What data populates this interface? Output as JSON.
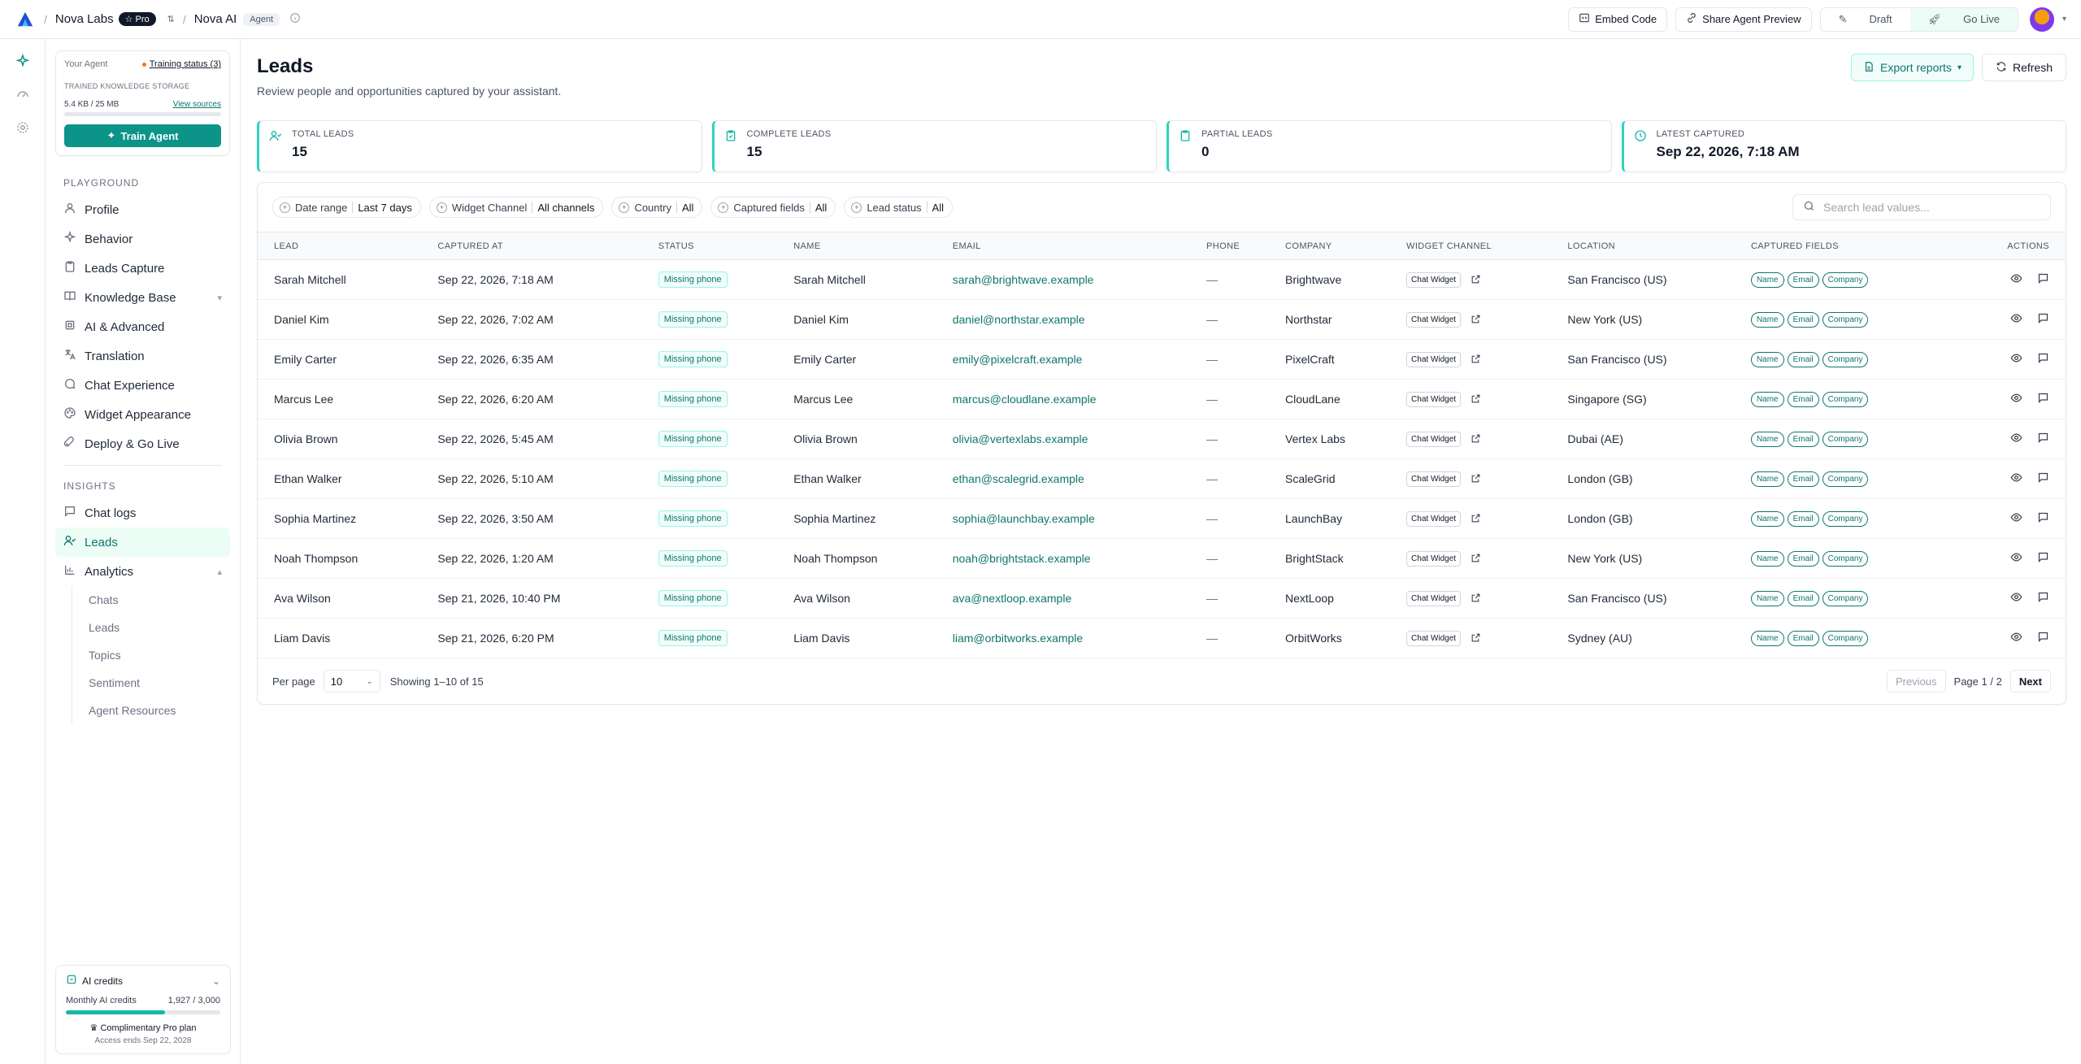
{
  "topbar": {
    "workspace": "Nova Labs",
    "plan_badge": "Pro",
    "agent_name": "Nova AI",
    "agent_badge": "Agent",
    "embed_label": "Embed Code",
    "share_label": "Share Agent Preview",
    "draft_label": "Draft",
    "live_label": "Go Live"
  },
  "sidebar": {
    "agent_card": {
      "title": "Your Agent",
      "training_status": "Training status (3)",
      "storage_label": "TRAINED KNOWLEDGE STORAGE",
      "storage_value": "5.4 KB / 25 MB",
      "view_sources": "View sources",
      "train_label": "Train Agent"
    },
    "playground_title": "PLAYGROUND",
    "playground_items": [
      {
        "label": "Profile"
      },
      {
        "label": "Behavior"
      },
      {
        "label": "Leads Capture"
      },
      {
        "label": "Knowledge Base"
      },
      {
        "label": "AI & Advanced"
      },
      {
        "label": "Translation"
      },
      {
        "label": "Chat Experience"
      },
      {
        "label": "Widget Appearance"
      },
      {
        "label": "Deploy & Go Live"
      }
    ],
    "insights_title": "INSIGHTS",
    "insights_items": [
      {
        "label": "Chat logs"
      },
      {
        "label": "Leads"
      },
      {
        "label": "Analytics"
      }
    ],
    "analytics_sub": [
      "Chats",
      "Leads",
      "Topics",
      "Sentiment",
      "Agent Resources"
    ],
    "credits": {
      "title": "AI credits",
      "monthly_label": "Monthly AI credits",
      "monthly_value": "1,927 / 3,000",
      "used_fraction": 0.642,
      "plan": "Complimentary Pro plan",
      "ends": "Access ends Sep 22, 2028"
    }
  },
  "main": {
    "title": "Leads",
    "subtitle": "Review people and opportunities captured by your assistant.",
    "export_label": "Export reports",
    "refresh_label": "Refresh",
    "stats": [
      {
        "label": "TOTAL LEADS",
        "value": "15"
      },
      {
        "label": "COMPLETE LEADS",
        "value": "15"
      },
      {
        "label": "PARTIAL LEADS",
        "value": "0"
      },
      {
        "label": "LATEST CAPTURED",
        "value": "Sep 22, 2026, 7:18 AM"
      }
    ],
    "filters": [
      {
        "label": "Date range",
        "value": "Last 7 days"
      },
      {
        "label": "Widget Channel",
        "value": "All channels"
      },
      {
        "label": "Country",
        "value": "All"
      },
      {
        "label": "Captured fields",
        "value": "All"
      },
      {
        "label": "Lead status",
        "value": "All"
      }
    ],
    "search_placeholder": "Search lead values...",
    "columns": [
      "LEAD",
      "CAPTURED AT",
      "STATUS",
      "NAME",
      "EMAIL",
      "PHONE",
      "COMPANY",
      "WIDGET CHANNEL",
      "LOCATION",
      "CAPTURED FIELDS",
      "ACTIONS"
    ],
    "rows": [
      {
        "lead": "Sarah Mitchell",
        "captured": "Sep 22, 2026, 7:18 AM",
        "status": "Missing phone",
        "name": "Sarah Mitchell",
        "email": "sarah@brightwave.example",
        "phone": "—",
        "company": "Brightwave",
        "channel": "Chat Widget",
        "location": "San Francisco (US)",
        "fields": [
          "Name",
          "Email",
          "Company"
        ]
      },
      {
        "lead": "Daniel Kim",
        "captured": "Sep 22, 2026, 7:02 AM",
        "status": "Missing phone",
        "name": "Daniel Kim",
        "email": "daniel@northstar.example",
        "phone": "—",
        "company": "Northstar",
        "channel": "Chat Widget",
        "location": "New York (US)",
        "fields": [
          "Name",
          "Email",
          "Company"
        ]
      },
      {
        "lead": "Emily Carter",
        "captured": "Sep 22, 2026, 6:35 AM",
        "status": "Missing phone",
        "name": "Emily Carter",
        "email": "emily@pixelcraft.example",
        "phone": "—",
        "company": "PixelCraft",
        "channel": "Chat Widget",
        "location": "San Francisco (US)",
        "fields": [
          "Name",
          "Email",
          "Company"
        ]
      },
      {
        "lead": "Marcus Lee",
        "captured": "Sep 22, 2026, 6:20 AM",
        "status": "Missing phone",
        "name": "Marcus Lee",
        "email": "marcus@cloudlane.example",
        "phone": "—",
        "company": "CloudLane",
        "channel": "Chat Widget",
        "location": "Singapore (SG)",
        "fields": [
          "Name",
          "Email",
          "Company"
        ]
      },
      {
        "lead": "Olivia Brown",
        "captured": "Sep 22, 2026, 5:45 AM",
        "status": "Missing phone",
        "name": "Olivia Brown",
        "email": "olivia@vertexlabs.example",
        "phone": "—",
        "company": "Vertex Labs",
        "channel": "Chat Widget",
        "location": "Dubai (AE)",
        "fields": [
          "Name",
          "Email",
          "Company"
        ]
      },
      {
        "lead": "Ethan Walker",
        "captured": "Sep 22, 2026, 5:10 AM",
        "status": "Missing phone",
        "name": "Ethan Walker",
        "email": "ethan@scalegrid.example",
        "phone": "—",
        "company": "ScaleGrid",
        "channel": "Chat Widget",
        "location": "London (GB)",
        "fields": [
          "Name",
          "Email",
          "Company"
        ]
      },
      {
        "lead": "Sophia Martinez",
        "captured": "Sep 22, 2026, 3:50 AM",
        "status": "Missing phone",
        "name": "Sophia Martinez",
        "email": "sophia@launchbay.example",
        "phone": "—",
        "company": "LaunchBay",
        "channel": "Chat Widget",
        "location": "London (GB)",
        "fields": [
          "Name",
          "Email",
          "Company"
        ]
      },
      {
        "lead": "Noah Thompson",
        "captured": "Sep 22, 2026, 1:20 AM",
        "status": "Missing phone",
        "name": "Noah Thompson",
        "email": "noah@brightstack.example",
        "phone": "—",
        "company": "BrightStack",
        "channel": "Chat Widget",
        "location": "New York (US)",
        "fields": [
          "Name",
          "Email",
          "Company"
        ]
      },
      {
        "lead": "Ava Wilson",
        "captured": "Sep 21, 2026, 10:40 PM",
        "status": "Missing phone",
        "name": "Ava Wilson",
        "email": "ava@nextloop.example",
        "phone": "—",
        "company": "NextLoop",
        "channel": "Chat Widget",
        "location": "San Francisco (US)",
        "fields": [
          "Name",
          "Email",
          "Company"
        ]
      },
      {
        "lead": "Liam Davis",
        "captured": "Sep 21, 2026, 6:20 PM",
        "status": "Missing phone",
        "name": "Liam Davis",
        "email": "liam@orbitworks.example",
        "phone": "—",
        "company": "OrbitWorks",
        "channel": "Chat Widget",
        "location": "Sydney (AU)",
        "fields": [
          "Name",
          "Email",
          "Company"
        ]
      }
    ],
    "pager": {
      "per_page_label": "Per page",
      "per_page_value": "10",
      "showing": "Showing 1–10 of 15",
      "previous": "Previous",
      "page": "Page 1 / 2",
      "next": "Next"
    }
  }
}
